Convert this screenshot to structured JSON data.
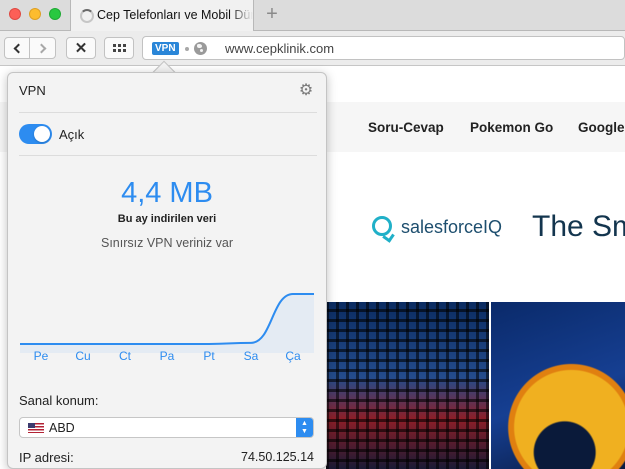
{
  "tab": {
    "title": "Cep Telefonları ve Mobil Dünya"
  },
  "toolbar": {
    "stop_glyph": "✕"
  },
  "address": {
    "vpn_badge": "VPN",
    "url": "www.cepklinik.com"
  },
  "site": {
    "nav": [
      "Soru-Cevap",
      "Pokemon Go",
      "Google"
    ],
    "ad_brand": "salesforceIQ",
    "ad_headline": "The Sm"
  },
  "popup": {
    "title": "VPN",
    "toggle_label": "Açık",
    "toggle_on": true,
    "data_amount": "4,4 MB",
    "data_caption": "Bu ay indirilen veri",
    "unlimited": "Sınırsız VPN veriniz var",
    "location_label": "Sanal konum:",
    "location_value": "ABD",
    "ip_label": "IP adresi:",
    "ip_value": "74.50.125.14",
    "accent_color": "#2d8cf0"
  },
  "chart_data": {
    "type": "area",
    "categories": [
      "Pe",
      "Cu",
      "Ct",
      "Pa",
      "Pt",
      "Sa",
      "Ça"
    ],
    "values": [
      0,
      0,
      0,
      0,
      0,
      0.1,
      4.4
    ],
    "title": "",
    "xlabel": "",
    "ylabel": "",
    "ylim": [
      0,
      4.4
    ],
    "grid": false
  }
}
